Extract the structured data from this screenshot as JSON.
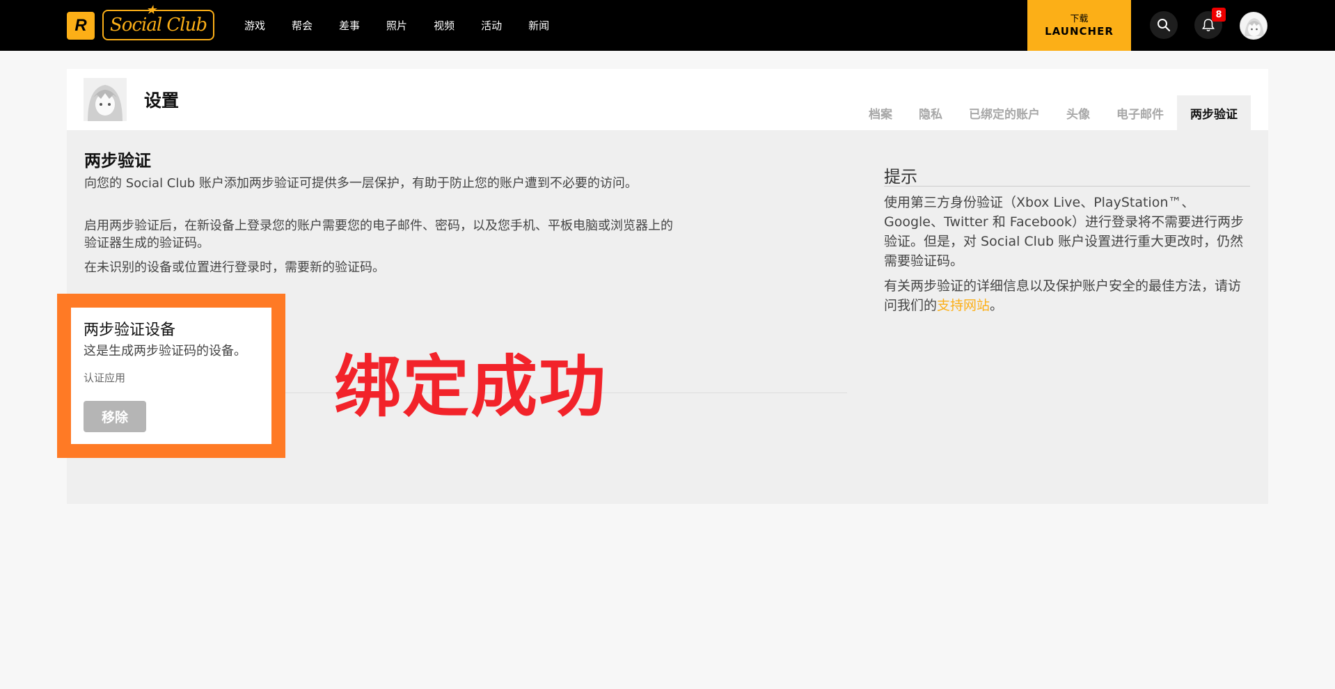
{
  "nav": {
    "logo_text": "R",
    "brand": "Social Club",
    "items": [
      "游戏",
      "帮会",
      "差事",
      "照片",
      "视频",
      "活动",
      "新闻"
    ],
    "launcher_line1": "下载",
    "launcher_line2": "LAUNCHER",
    "notification_count": "8"
  },
  "header": {
    "title": "设置",
    "tabs": [
      "档案",
      "隐私",
      "已绑定的账户",
      "头像",
      "电子邮件",
      "两步验证"
    ],
    "active_tab": "两步验证"
  },
  "main": {
    "title": "两步验证",
    "paragraphs": [
      "向您的 Social Club 账户添加两步验证可提供多一层保护，有助于防止您的账户遭到不必要的访问。",
      "启用两步验证后，在新设备上登录您的账户需要您的电子邮件、密码，以及您手机、平板电脑或浏览器上的验证器生成的验证码。",
      "在未识别的设备或位置进行登录时，需要新的验证码。"
    ],
    "device": {
      "title": "两步验证设备",
      "description": "这是生成两步验证码的设备。",
      "type": "认证应用",
      "remove_label": "移除"
    },
    "overlay": "绑定成功"
  },
  "tips": {
    "title": "提示",
    "p1": "使用第三方身份验证（Xbox Live、PlayStation™、Google、Twitter 和 Facebook）进行登录将不需要进行两步验证。但是，对 Social Club 账户设置进行重大更改时，仍然需要验证码。",
    "p2_prefix": "有关两步验证的详细信息以及保护账户安全的最佳方法，请访问我们的",
    "p2_link": "支持网站",
    "p2_suffix": "。"
  },
  "colors": {
    "accent": "#fcaf17",
    "highlight_border": "#ff7a25",
    "overlay_text": "#f2232a"
  }
}
